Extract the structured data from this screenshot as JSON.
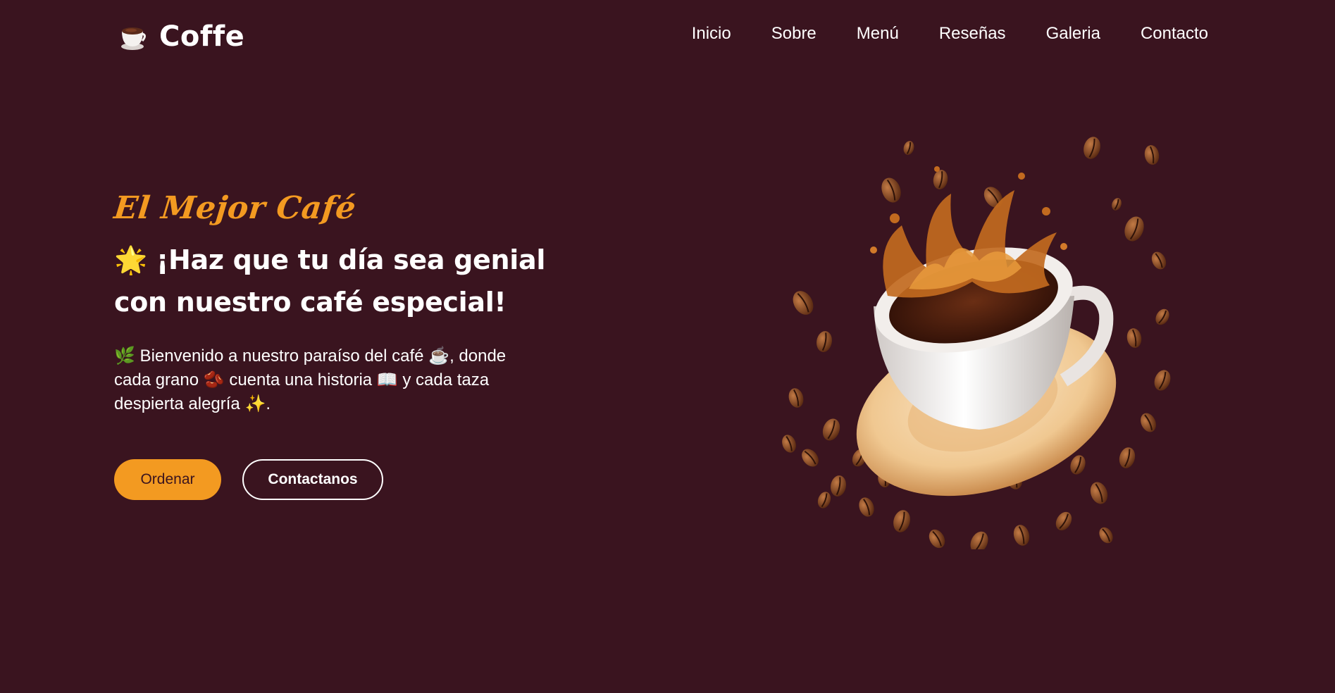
{
  "brand": {
    "name": "Coffe",
    "icon": "coffee-cup-icon"
  },
  "nav": {
    "items": [
      {
        "label": "Inicio"
      },
      {
        "label": "Sobre"
      },
      {
        "label": "Menú"
      },
      {
        "label": "Reseñas"
      },
      {
        "label": "Galeria"
      },
      {
        "label": "Contacto"
      }
    ]
  },
  "hero": {
    "tagline": "El Mejor Café",
    "headline_emoji": "🌟",
    "headline": "¡Haz que tu día sea genial con nuestro café especial!",
    "intro": [
      {
        "t": "🌿",
        "e": true
      },
      {
        "t": " Bienvenido a nuestro paraíso del café "
      },
      {
        "t": "☕",
        "e": true
      },
      {
        "t": ", donde cada grano "
      },
      {
        "t": "🫘",
        "e": true
      },
      {
        "t": " cuenta una historia "
      },
      {
        "t": "📖",
        "e": true
      },
      {
        "t": " y cada taza despierta alegría "
      },
      {
        "t": "✨",
        "e": true
      },
      {
        "t": "."
      }
    ],
    "buttons": {
      "primary": "Ordenar",
      "secondary": "Contactanos"
    },
    "image": "coffee-cup-splash-with-beans"
  },
  "colors": {
    "background": "#3a141f",
    "accent": "#f39a21",
    "text": "#ffffff"
  }
}
